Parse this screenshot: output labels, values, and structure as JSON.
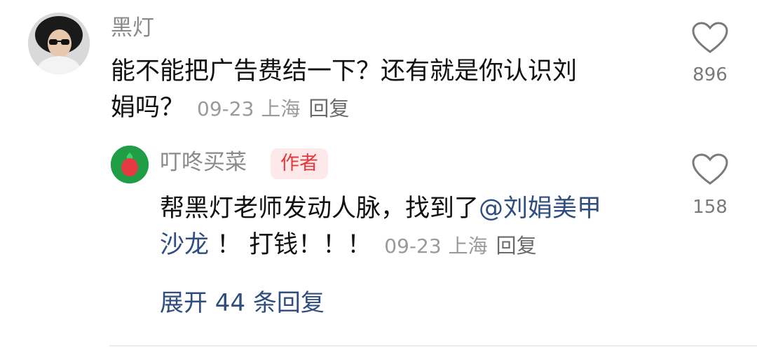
{
  "comment": {
    "username": "黑灯",
    "text_line1": "能不能把广告费结一下？还有就是你认识刘",
    "text_line2": "娟吗？",
    "date": "09-23",
    "location": "上海",
    "reply_label": "回复",
    "like_count": "896"
  },
  "reply": {
    "username": "叮咚买菜",
    "author_badge": "作者",
    "text_part1": "帮黑灯老师发动人脉，找到了",
    "mention": "@刘娟美甲",
    "mention_line2": "沙龙",
    "text_part2": " ！ 打钱！！！",
    "date": "09-23",
    "location": "上海",
    "reply_label": "回复",
    "like_count": "158"
  },
  "expand_replies": "展开 44 条回复",
  "colors": {
    "link": "#2f4d7f",
    "badge_bg": "#fde9ea",
    "badge_text": "#e4393c",
    "brand_green": "#1f9e47"
  },
  "icons": {
    "like": "heart-outline-icon",
    "reply_avatar": "radish-logo-icon"
  }
}
